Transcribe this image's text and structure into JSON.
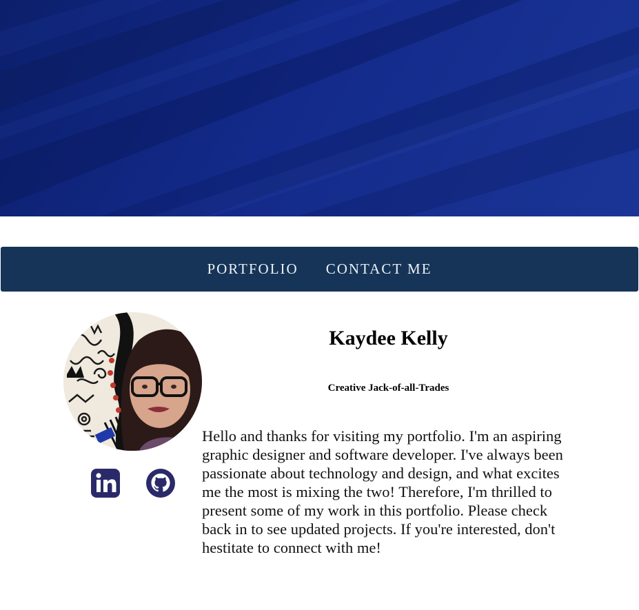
{
  "nav": {
    "items": [
      {
        "label": "PORTFOLIO"
      },
      {
        "label": "CONTACT ME"
      }
    ]
  },
  "profile": {
    "name": "Kaydee Kelly",
    "tagline": "Creative Jack-of-all-Trades",
    "bio": "Hello and thanks for visiting my portfolio. I'm an aspiring graphic designer and software developer. I've always been passionate about technology and design, and what excites me the most is mixing the two! Therefore, I'm thrilled to present some of my work in this portfolio. Please check back in to see updated projects. If you're interested, don't hestitate to connect with me!"
  },
  "social": {
    "icons": [
      "linkedin-icon",
      "github-icon"
    ],
    "icon_color": "#2a2a6a"
  },
  "colors": {
    "hero": "#132a8a",
    "navbar": "#163458",
    "nav_text": "#eef1f7"
  }
}
